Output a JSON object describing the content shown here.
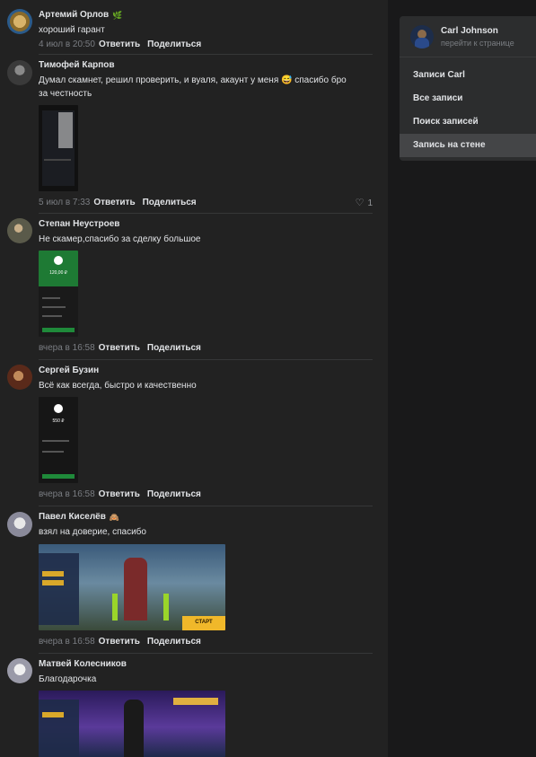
{
  "comments": [
    {
      "author": "Артемий Орлов",
      "badge": "🌿",
      "text": "хороший гарант",
      "time": "4 июл в 20:50",
      "reply": "Ответить",
      "share": "Поделиться"
    },
    {
      "author": "Тимофей Карпов",
      "text_line1": "Думал скамнет, решил проверить, и вуаля, акаунт у меня 😅 спасибо бро",
      "text_line2": "за честность",
      "time": "5 июл в 7:33",
      "reply": "Ответить",
      "share": "Поделиться",
      "likes": "1"
    },
    {
      "author": "Степан Неустроев",
      "text": "Не скамер,спасибо за сделку большое",
      "time": "вчера в 16:58",
      "reply": "Ответить",
      "share": "Поделиться"
    },
    {
      "author": "Сергей Бузин",
      "text": "Всё как всегда, быстро и качественно",
      "time": "вчера в 16:58",
      "reply": "Ответить",
      "share": "Поделиться"
    },
    {
      "author": "Павел Киселёв",
      "badge": "🙈",
      "text": "взял на доверие, спасибо",
      "time": "вчера в 16:58",
      "reply": "Ответить",
      "share": "Поделиться"
    },
    {
      "author": "Матвей Колесников",
      "text": "Благодарочка"
    }
  ],
  "thumb_text": {
    "amount1": "120,00 ₽",
    "amount2": "550 ₽",
    "start": "СТАРТ"
  },
  "sidebar": {
    "name": "Carl Johnson",
    "link": "перейти к странице",
    "items": [
      "Записи Carl",
      "Все записи",
      "Поиск записей",
      "Запись на стене"
    ]
  },
  "colors": {
    "background": "#222222",
    "sidebar_card": "#2c2d2e",
    "active_item": "#444547",
    "muted": "#7a7d82"
  }
}
